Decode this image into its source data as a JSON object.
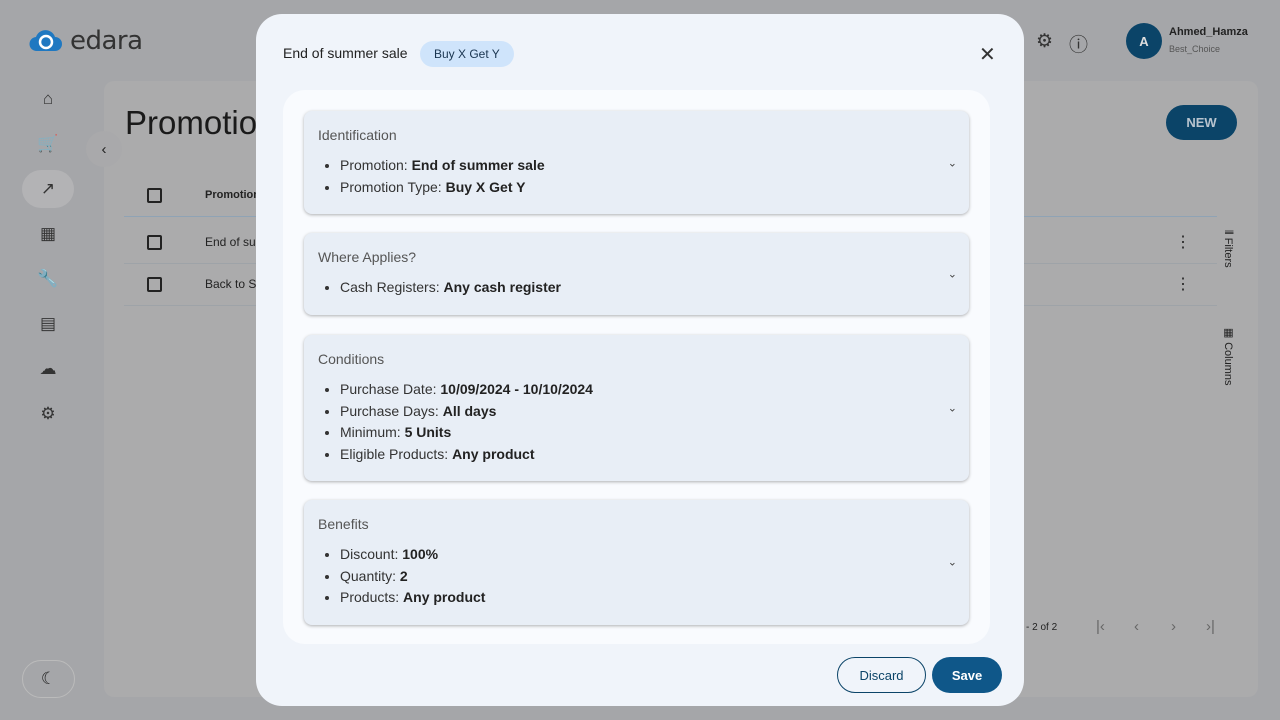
{
  "app": {
    "logo": "edara",
    "brand_color": "#0b4468"
  },
  "nav": [
    {
      "icon": "home-icon",
      "g": "⌂"
    },
    {
      "icon": "cart-icon",
      "g": "🛒"
    },
    {
      "icon": "trending-up-icon",
      "g": "↗",
      "active": true
    },
    {
      "icon": "building-icon",
      "g": "▦"
    },
    {
      "icon": "wrench-icon",
      "g": "🔧"
    },
    {
      "icon": "receipt-icon",
      "g": "▤"
    },
    {
      "icon": "cloud-icon",
      "g": "☁"
    },
    {
      "icon": "settings-icon",
      "g": "⚙"
    }
  ],
  "user": {
    "initial": "A",
    "name": "Ahmed_Hamza",
    "company": "Best_Choice"
  },
  "page": {
    "title": "Promotions",
    "new_label": "NEW",
    "column_header": "Promotion",
    "rows": [
      "End of summer sale",
      "Back to School"
    ],
    "filters_label": "Filters",
    "columns_label": "Columns",
    "pagination": "- 2 of 2"
  },
  "modal": {
    "title": "End of summer sale",
    "chip": "Buy X Get Y",
    "sections": [
      {
        "title": "Identification",
        "items": [
          [
            "Promotion: ",
            "End of summer sale"
          ],
          [
            "Promotion Type: ",
            "Buy X Get Y"
          ]
        ]
      },
      {
        "title": "Where Applies?",
        "items": [
          [
            "Cash Registers: ",
            "Any cash register"
          ]
        ]
      },
      {
        "title": "Conditions",
        "items": [
          [
            "Purchase Date: ",
            "10/09/2024 - 10/10/2024"
          ],
          [
            "Purchase Days: ",
            "All days"
          ],
          [
            "Minimum: ",
            "5 Units"
          ],
          [
            "Eligible Products: ",
            "Any product"
          ]
        ]
      },
      {
        "title": "Benefits",
        "items": [
          [
            "Discount: ",
            "100%"
          ],
          [
            "Quantity: ",
            "2"
          ],
          [
            "Products: ",
            "Any product"
          ]
        ]
      }
    ],
    "discard_label": "Discard",
    "save_label": "Save"
  }
}
